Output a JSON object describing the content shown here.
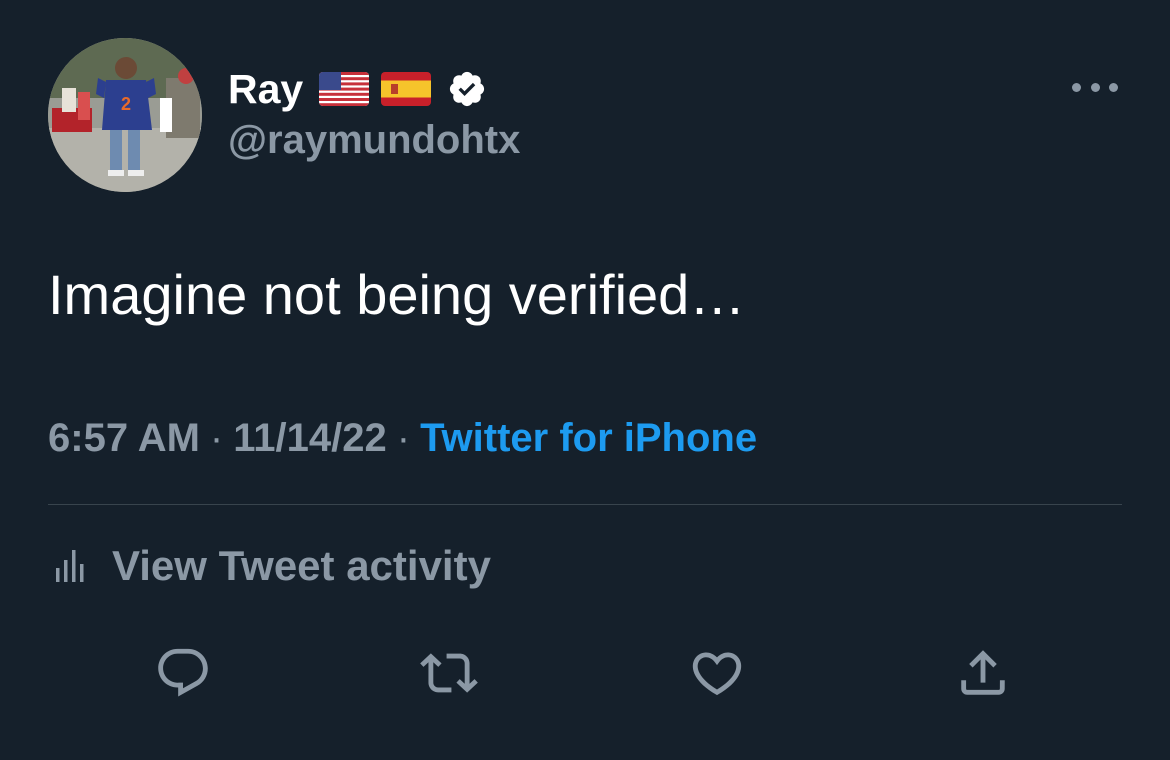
{
  "tweet": {
    "author": {
      "display_name": "Ray",
      "handle": "@raymundohtx",
      "verified": true,
      "flags": [
        "us-flag-icon",
        "spain-flag-icon"
      ]
    },
    "text": "Imagine not being verified…",
    "time": "6:57 AM",
    "date": "11/14/22",
    "separator": "·",
    "source": "Twitter for iPhone",
    "activity_label": "View Tweet activity"
  },
  "actions": [
    {
      "name": "reply",
      "icon": "reply-icon"
    },
    {
      "name": "retweet",
      "icon": "retweet-icon"
    },
    {
      "name": "like",
      "icon": "heart-icon"
    },
    {
      "name": "share",
      "icon": "share-icon"
    }
  ],
  "colors": {
    "background": "#15202b",
    "primary_text": "#ffffff",
    "secondary_text": "#8b98a5",
    "link": "#1d9bf0",
    "divider": "#38444d"
  }
}
